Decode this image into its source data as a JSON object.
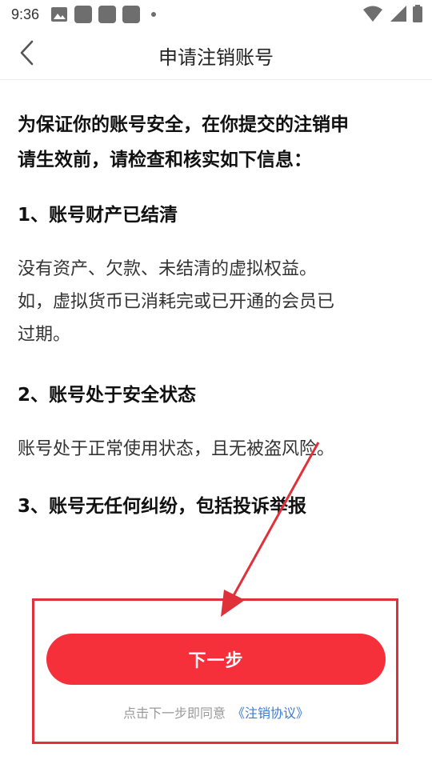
{
  "status_bar": {
    "time": "9:36",
    "icons": [
      "image-icon",
      "app-icon",
      "app-icon",
      "app-icon",
      "dot-icon",
      "wifi-icon",
      "signal-icon",
      "battery-icon"
    ]
  },
  "nav": {
    "title": "申请注销账号",
    "back_icon": "chevron-left-icon"
  },
  "content": {
    "intro_line1": "为保证你的账号安全，在你提交的注销申",
    "intro_line2": "请生效前，请检查和核实如下信息：",
    "sections": [
      {
        "heading": "1、账号财产已结清",
        "lines": [
          "没有资产、欠款、未结清的虚拟权益。",
          "如，虚拟货币已消耗完或已开通的会员已",
          "过期。"
        ]
      },
      {
        "heading": "2、账号处于安全状态",
        "lines": [
          "账号处于正常使用状态，且无被盗风险。"
        ]
      },
      {
        "heading": "3、账号无任何纠纷，包括投诉举报",
        "lines": []
      }
    ]
  },
  "footer": {
    "next_button_label": "下一步",
    "agree_text": "点击下一步即同意",
    "agreement_link": "《注销协议》"
  },
  "colors": {
    "accent": "#f5303a",
    "annotation": "#e0303a",
    "link": "#3a7bd5"
  }
}
